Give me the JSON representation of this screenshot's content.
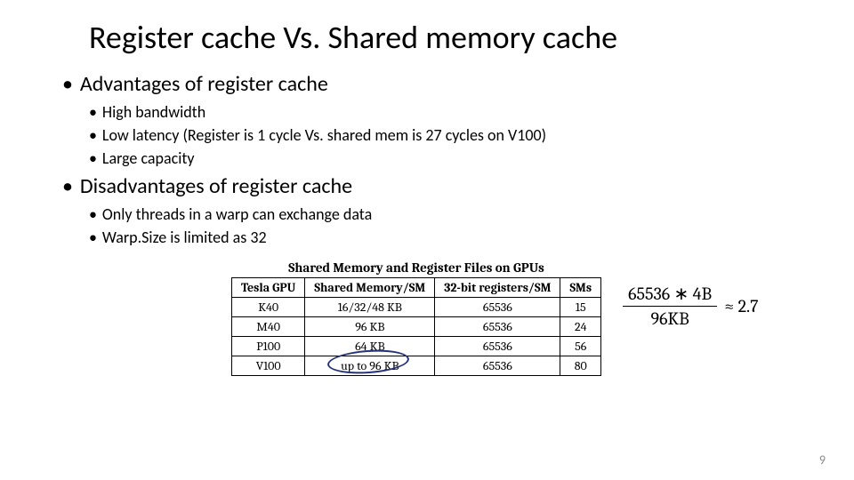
{
  "title": "Register cache Vs. Shared memory cache",
  "sections": [
    {
      "heading": "Advantages of register cache",
      "items": [
        "High bandwidth",
        "Low latency (Register is 1 cycle Vs. shared mem is 27 cycles on V100)",
        "Large capacity"
      ]
    },
    {
      "heading": "Disadvantages of register cache",
      "items": [
        "Only threads in a warp can exchange data",
        "Warp.Size is limited as 32"
      ]
    }
  ],
  "table": {
    "caption": "Shared Memory and Register Files on GPUs",
    "headers": [
      "Tesla GPU",
      "Shared Memory/SM",
      "32-bit registers/SM",
      "SMs"
    ],
    "rows": [
      [
        "K40",
        "16/32/48 KB",
        "65536",
        "15"
      ],
      [
        "M40",
        "96 KB",
        "65536",
        "24"
      ],
      [
        "P100",
        "64 KB",
        "65536",
        "56"
      ],
      [
        "V100",
        "up to 96 KB",
        "65536",
        "80"
      ]
    ]
  },
  "equation": {
    "numerator": "65536 ∗ 4B",
    "denominator": "96KB",
    "approx": "≈ 2.7"
  },
  "page_number": "9"
}
